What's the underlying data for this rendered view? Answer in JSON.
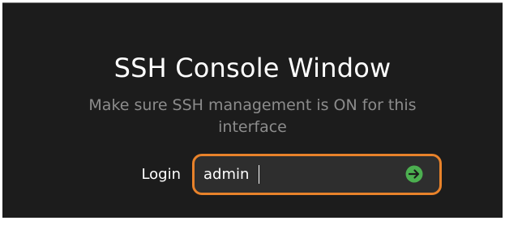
{
  "window": {
    "title": "SSH Console Window",
    "subtitle": "Make sure SSH management is ON for this interface"
  },
  "login": {
    "label": "Login",
    "value": "admin",
    "submit_icon": "arrow-right-circle-icon"
  },
  "colors": {
    "background": "#1c1c1c",
    "input_border": "#e8822a",
    "submit_icon": "#4caf50"
  }
}
